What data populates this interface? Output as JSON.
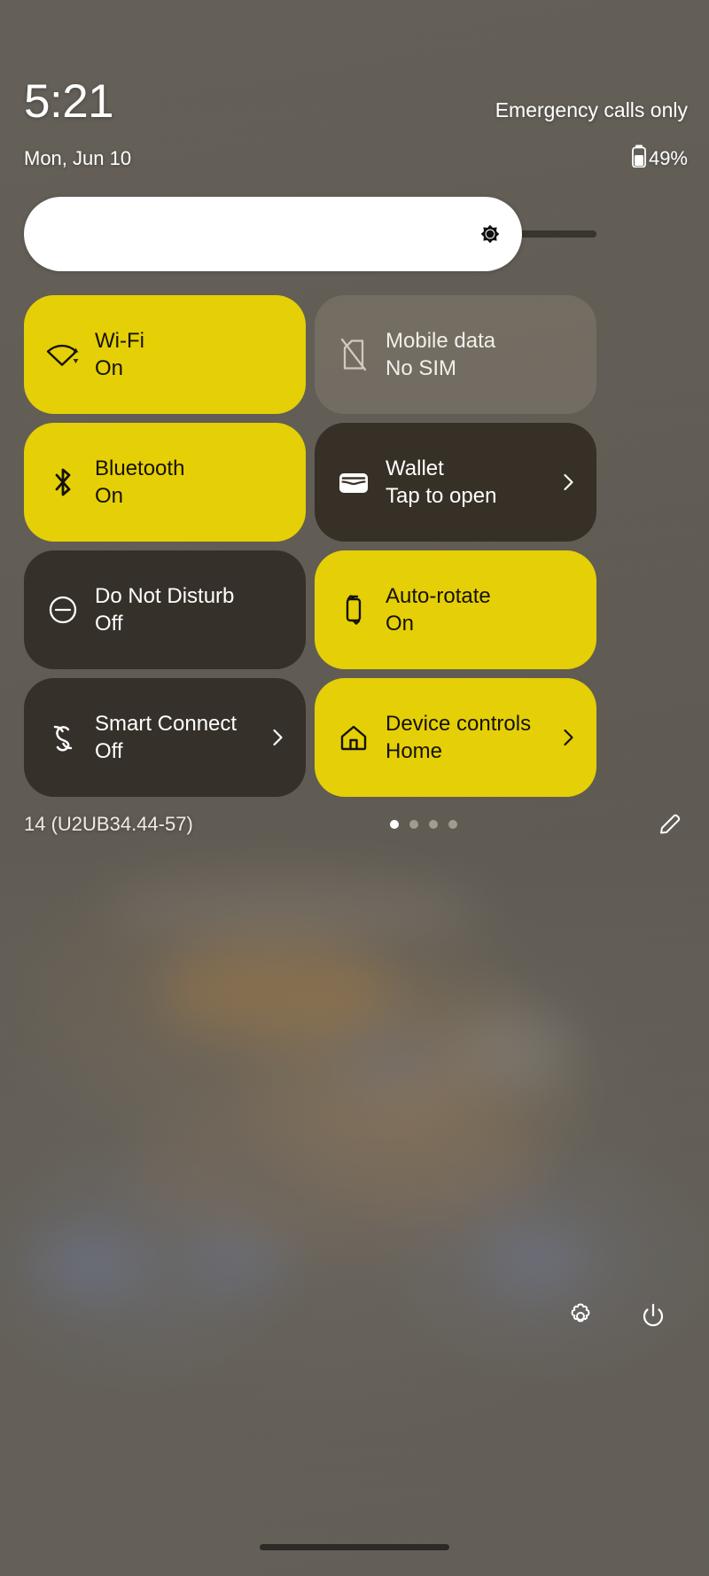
{
  "status": {
    "clock": "5:21",
    "carrier": "Emergency calls only",
    "date": "Mon, Jun 10",
    "battery_percent": "49%",
    "battery_icon": "battery-icon"
  },
  "brightness": {
    "icon": "brightness-icon",
    "level_percent": 87
  },
  "tiles": [
    {
      "title": "Wi-Fi",
      "subtitle": "On",
      "state": "on",
      "icon": "wifi-icon",
      "chevron": false
    },
    {
      "title": "Mobile data",
      "subtitle": "No SIM",
      "state": "off-light",
      "icon": "no-sim-icon",
      "chevron": false
    },
    {
      "title": "Bluetooth",
      "subtitle": "On",
      "state": "on",
      "icon": "bluetooth-icon",
      "chevron": false
    },
    {
      "title": "Wallet",
      "subtitle": "Tap to open",
      "state": "off-wallet",
      "icon": "wallet-icon",
      "chevron": true
    },
    {
      "title": "Do Not Disturb",
      "subtitle": "Off",
      "state": "off-dark",
      "icon": "do-not-disturb-icon",
      "chevron": false
    },
    {
      "title": "Auto-rotate",
      "subtitle": "On",
      "state": "on",
      "icon": "auto-rotate-icon",
      "chevron": false
    },
    {
      "title": "Smart Connect",
      "subtitle": "Off",
      "state": "off-dark",
      "icon": "smart-connect-icon",
      "chevron": true
    },
    {
      "title": "Device controls",
      "subtitle": "Home",
      "state": "on",
      "icon": "home-icon",
      "chevron": true
    }
  ],
  "footer": {
    "build": "14 (U2UB34.44-57)",
    "page_dots": 4,
    "active_dot": 1,
    "edit_icon": "edit-pencil-icon"
  },
  "bottom_bar": {
    "settings_icon": "gear-icon",
    "power_icon": "power-icon"
  },
  "colors": {
    "accent_on": "#e5cf06",
    "tile_off_dark": "rgba(42,37,31,0.80)",
    "text_on_accent": "#151208",
    "text_on_dark": "#ffffff"
  }
}
